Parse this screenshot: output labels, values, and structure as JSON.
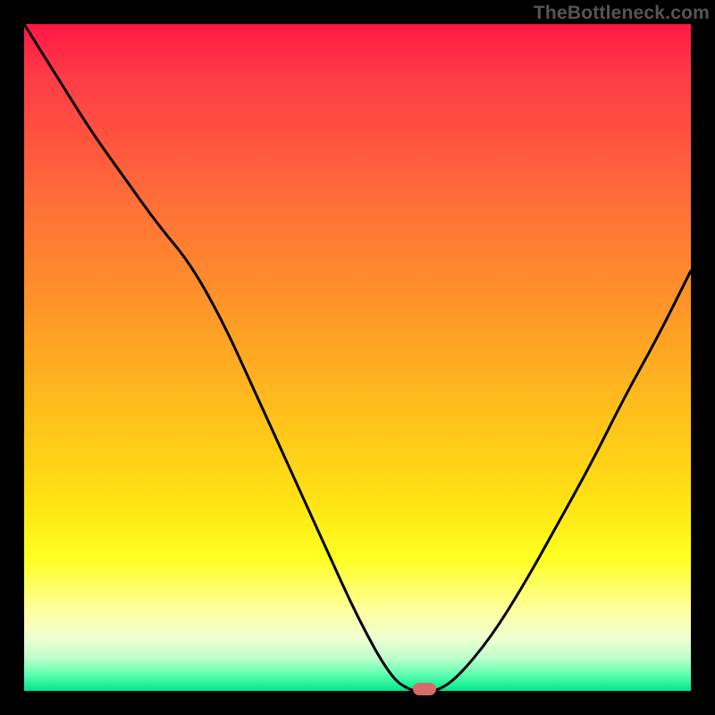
{
  "watermark": "TheBottleneck.com",
  "chart_data": {
    "type": "line",
    "title": "",
    "xlabel": "",
    "ylabel": "",
    "x": [
      0.0,
      0.05,
      0.1,
      0.15,
      0.2,
      0.25,
      0.3,
      0.35,
      0.4,
      0.45,
      0.5,
      0.55,
      0.58,
      0.6,
      0.62,
      0.65,
      0.7,
      0.75,
      0.8,
      0.85,
      0.9,
      0.95,
      1.0
    ],
    "values": [
      1.0,
      0.92,
      0.84,
      0.77,
      0.7,
      0.64,
      0.55,
      0.44,
      0.33,
      0.22,
      0.11,
      0.02,
      0.0,
      0.0,
      0.0,
      0.02,
      0.08,
      0.16,
      0.25,
      0.34,
      0.44,
      0.53,
      0.63
    ],
    "xlim": [
      0,
      1
    ],
    "ylim": [
      0,
      1
    ],
    "marker": {
      "x": 0.6,
      "y": 0.0,
      "color": "#d86a6a"
    },
    "background_gradient": {
      "top": "#ff1744",
      "mid": "#ffe414",
      "bottom": "#00e68c"
    }
  }
}
